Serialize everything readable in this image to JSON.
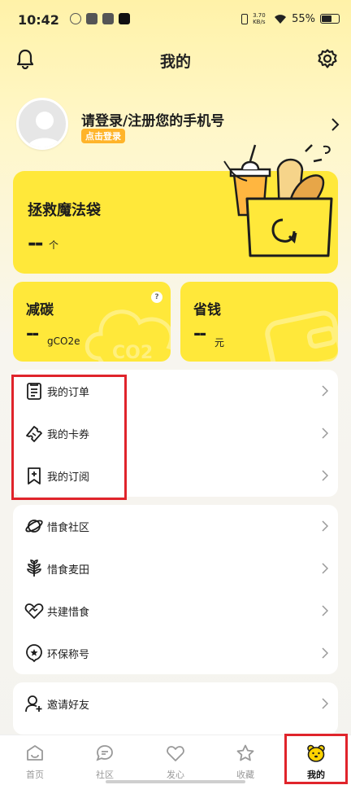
{
  "status": {
    "time": "10:42",
    "net_speed": "3.70 KB/s",
    "battery": "55%",
    "battery_level": 0.55
  },
  "header": {
    "title": "我的"
  },
  "profile": {
    "login_prompt": "请登录/注册您的手机号",
    "login_badge": "点击登录"
  },
  "magic_bag": {
    "title": "拯救魔法袋",
    "count": "--",
    "unit": "个"
  },
  "carbon": {
    "title": "减碳",
    "value": "--",
    "unit": "gCO2e",
    "help": "?"
  },
  "savings": {
    "title": "省钱",
    "value": "--",
    "unit": "元"
  },
  "menu_group1": [
    {
      "label": "我的订单",
      "icon": "order-icon"
    },
    {
      "label": "我的卡券",
      "icon": "coupon-icon"
    },
    {
      "label": "我的订阅",
      "icon": "subscription-icon"
    }
  ],
  "menu_group2": [
    {
      "label": "惜食社区",
      "icon": "planet-icon"
    },
    {
      "label": "惜食麦田",
      "icon": "wheat-icon"
    },
    {
      "label": "共建惜食",
      "icon": "heart-hands-icon"
    },
    {
      "label": "环保称号",
      "icon": "badge-icon"
    }
  ],
  "menu_group3": [
    {
      "label": "邀请好友",
      "icon": "add-user-icon"
    }
  ],
  "tabs": [
    {
      "label": "首页",
      "icon": "home-icon"
    },
    {
      "label": "社区",
      "icon": "chat-icon"
    },
    {
      "label": "发心",
      "icon": "heart-icon"
    },
    {
      "label": "收藏",
      "icon": "star-icon"
    },
    {
      "label": "我的",
      "icon": "bear-icon",
      "active": true
    }
  ],
  "colors": {
    "brand_yellow": "#ffe83a",
    "badge_orange": "#ffb42a",
    "highlight_red": "#e0242b"
  }
}
